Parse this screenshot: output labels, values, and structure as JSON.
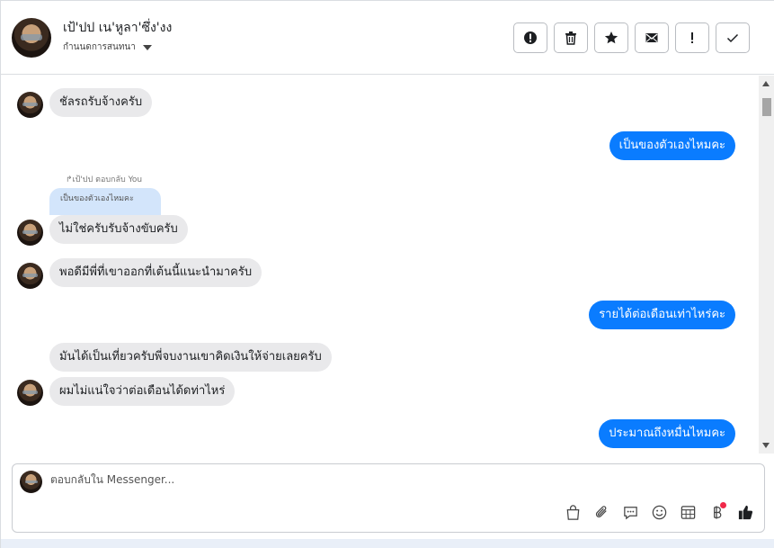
{
  "header": {
    "name": "เป้'ปป เน'หูลา'ซึ่ง'งง",
    "status": "กำนนดการสนทนา",
    "actions": [
      {
        "icon": "alert-circle-icon",
        "title": "spam"
      },
      {
        "icon": "trash-icon",
        "title": "delete"
      },
      {
        "icon": "star-icon",
        "title": "star"
      },
      {
        "icon": "mail-icon",
        "title": "mark unread"
      },
      {
        "icon": "exclamation-icon",
        "title": "follow up"
      },
      {
        "icon": "check-icon",
        "title": "done"
      }
    ]
  },
  "messages": [
    {
      "side": "in",
      "text": "ชัลรถรับจ้างครับ",
      "avatar": true
    },
    {
      "side": "out",
      "text": "เป็นของตัวเองไหมคะ"
    },
    {
      "side": "in",
      "text": "ไม่ใช่ครับรับจ้างขับครับ",
      "avatar": true,
      "reply_meta": "เป้'ปป ตอบกลับ You",
      "reply_quote": "เป็นของตัวเองไหมคะ"
    },
    {
      "side": "in",
      "text": "พอดีมีพี่ที่เขาออกที่เต้นนี้แนะนำมาครับ",
      "avatar": true
    },
    {
      "side": "out",
      "text": "รายได้ต่อเดือนเท่าไหร่คะ"
    },
    {
      "side": "in",
      "text": "มันได้เป็นเที่ยวครับพี่จบงานเขาคิดเงินให้จ่ายเลยครับ"
    },
    {
      "side": "in",
      "text": "ผมไม่แน่ใจว่าต่อเดือนได้ดท่าไหร่",
      "avatar": true
    },
    {
      "side": "out",
      "text": "ประมาณถึงหมื่นไหมคะ"
    }
  ],
  "composer": {
    "placeholder": "ตอบกลับใน Messenger...",
    "tools": [
      "bag-icon",
      "paperclip-icon",
      "chat-bubble-icon",
      "emoji-icon",
      "table-icon",
      "baht-icon",
      "thumbs-up-icon"
    ]
  },
  "colors": {
    "outgoing": "#0a7cff",
    "incoming": "#e9e9eb",
    "reply_quote": "#d3e5fb",
    "notification_dot": "#f02849"
  }
}
